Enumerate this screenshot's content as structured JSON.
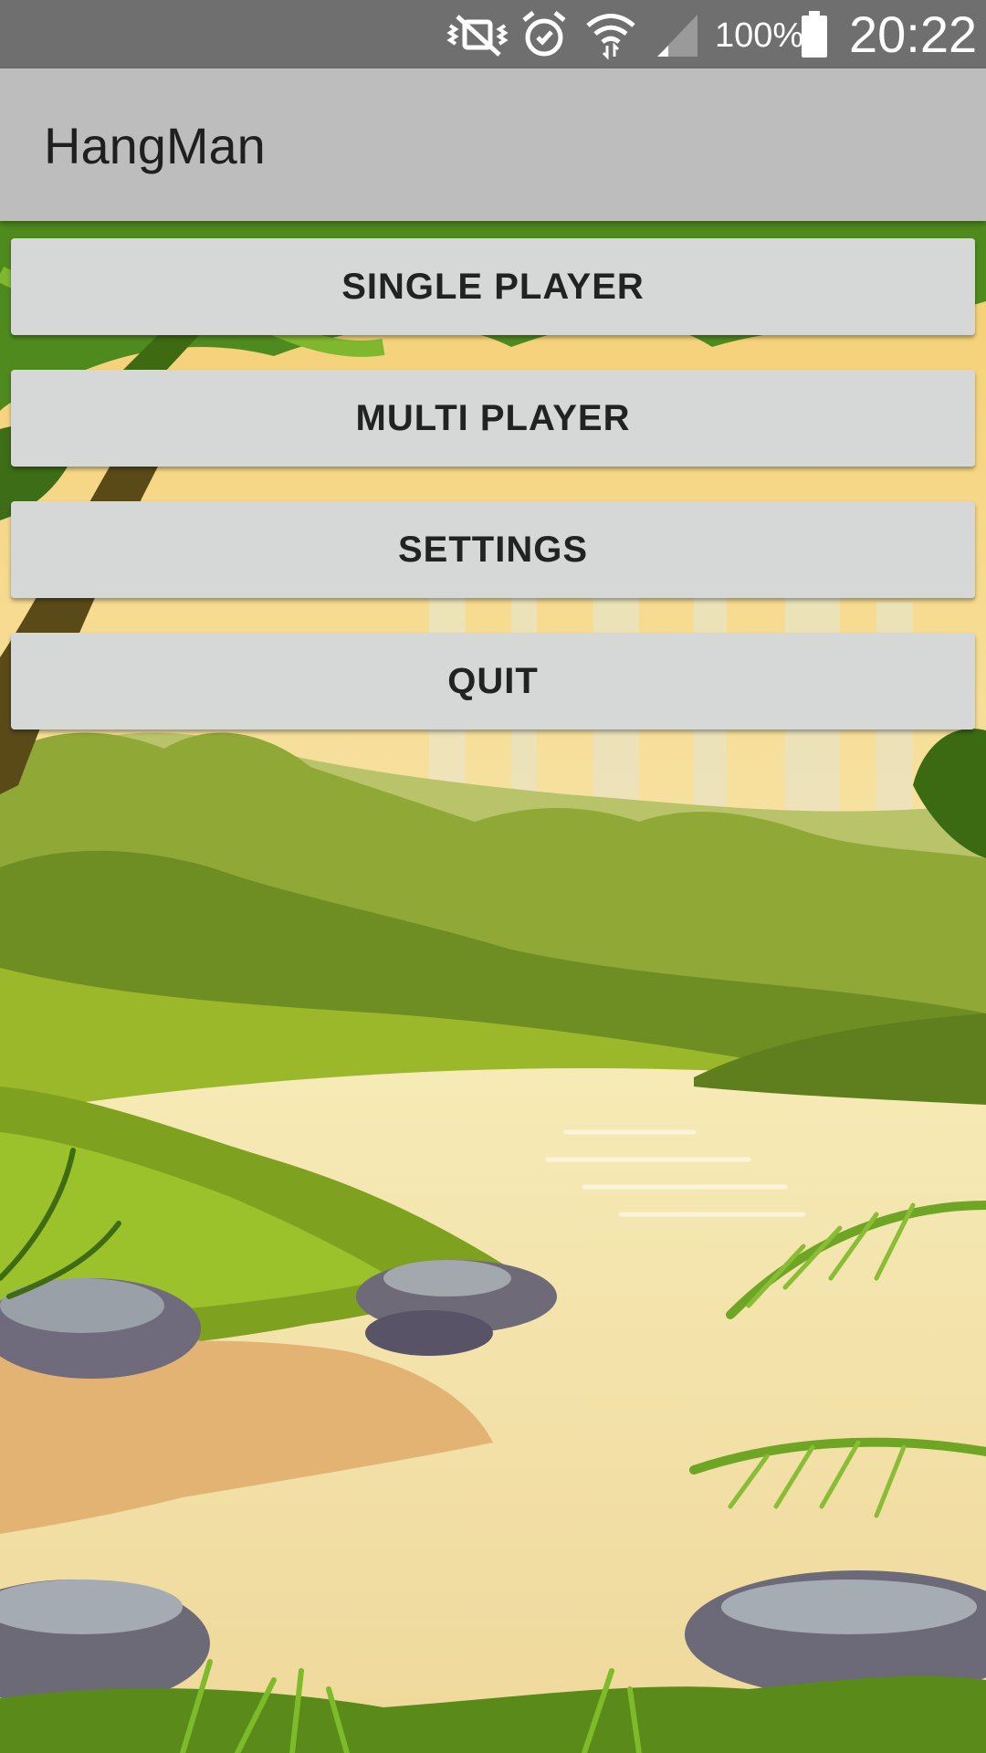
{
  "status_bar": {
    "icons": [
      "mute-icon",
      "alarm-icon",
      "wifi-icon",
      "signal-icon",
      "battery-icon"
    ],
    "battery_percent": "100%",
    "time": "20:22",
    "background_color": "#6f6f6f"
  },
  "app_bar": {
    "title": "HangMan",
    "background_color": "#bdbdbd"
  },
  "menu": {
    "single_player": "SINGLE PLAYER",
    "multi_player": "MULTI PLAYER",
    "settings": "SETTINGS",
    "quit": "QUIT",
    "button_color": "#d6d7d7"
  }
}
